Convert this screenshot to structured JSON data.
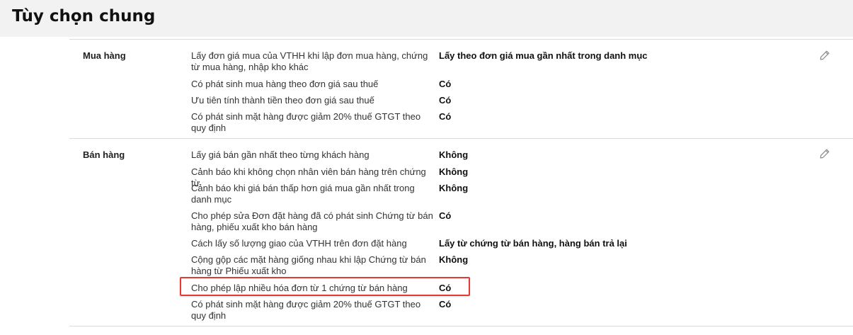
{
  "page": {
    "title": "Tùy chọn chung"
  },
  "sections": {
    "purchase": {
      "label": "Mua hàng",
      "rows": [
        {
          "label": "Lấy đơn giá mua của VTHH khi lập đơn mua hàng, chứng từ mua hàng, nhập kho khác",
          "value": "Lấy theo đơn giá mua gần nhất trong danh mục"
        },
        {
          "label": "Có phát sinh mua hàng theo đơn giá sau thuế",
          "value": "Có"
        },
        {
          "label": "Ưu tiên tính thành tiền theo đơn giá sau thuế",
          "value": "Có"
        },
        {
          "label": "Có phát sinh mặt hàng được giảm 20% thuế GTGT theo quy định",
          "value": "Có"
        }
      ]
    },
    "sales": {
      "label": "Bán hàng",
      "rows": [
        {
          "label": "Lấy giá bán gần nhất theo từng khách hàng",
          "value": "Không"
        },
        {
          "label": "Cảnh báo khi không chọn nhân viên bán hàng trên chứng từ",
          "value": "Không"
        },
        {
          "label": "Cảnh báo khi giá bán thấp hơn giá mua gần nhất trong danh mục",
          "value": "Không"
        },
        {
          "label": "Cho phép sửa Đơn đặt hàng đã có phát sinh Chứng từ bán hàng, phiếu xuất kho bán hàng",
          "value": "Có"
        },
        {
          "label": "Cách lấy số lượng giao của VTHH trên đơn đặt hàng",
          "value": "Lấy từ chứng từ bán hàng, hàng bán trả lại"
        },
        {
          "label": "Cộng gộp các mặt hàng giống nhau khi lập Chứng từ bán hàng từ Phiếu xuất kho",
          "value": "Không"
        },
        {
          "label": "Cho phép lập nhiều hóa đơn từ 1 chứng từ bán hàng",
          "value": "Có"
        },
        {
          "label": "Có phát sinh mặt hàng được giảm 20% thuế GTGT theo quy định",
          "value": "Có"
        }
      ]
    }
  },
  "icons": {
    "edit": "pencil-icon"
  },
  "colors": {
    "highlight": "#e53935",
    "header_bg": "#f2f2f2"
  }
}
